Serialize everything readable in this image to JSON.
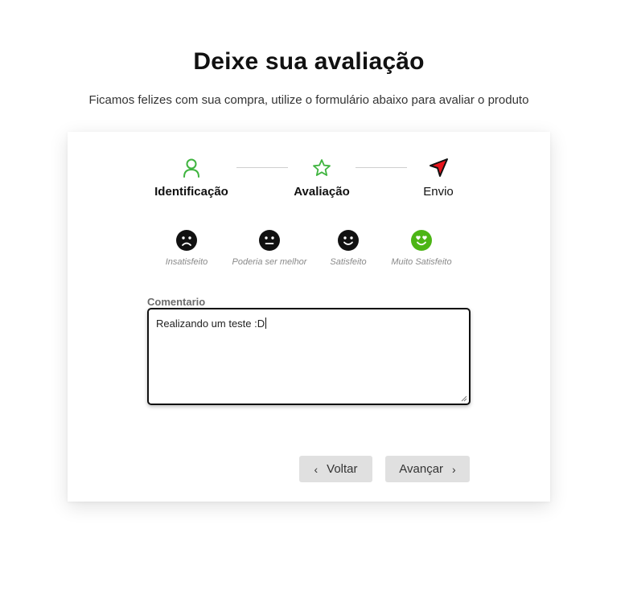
{
  "header": {
    "title": "Deixe sua avaliação",
    "subtitle": "Ficamos felizes com sua compra, utilize o formulário abaixo para avaliar o produto"
  },
  "steps": [
    {
      "label": "Identificação",
      "icon": "user-icon",
      "state": "completed"
    },
    {
      "label": "Avaliação",
      "icon": "star-icon",
      "state": "active"
    },
    {
      "label": "Envio",
      "icon": "send-icon",
      "state": "pending"
    }
  ],
  "ratings": [
    {
      "label": "Insatisfeito",
      "icon": "sad-face-icon",
      "selected": false
    },
    {
      "label": "Poderia ser melhor",
      "icon": "neutral-face-icon",
      "selected": false
    },
    {
      "label": "Satisfeito",
      "icon": "smile-face-icon",
      "selected": false
    },
    {
      "label": "Muito Satisfeito",
      "icon": "heart-eyes-face-icon",
      "selected": true
    }
  ],
  "comment": {
    "label": "Comentario",
    "value": "Realizando um teste :D"
  },
  "buttons": {
    "back": "Voltar",
    "next": "Avançar"
  },
  "colors": {
    "accent_green": "#3fb43f",
    "selected_face": "#4cb515",
    "send_red": "#e8141c",
    "button_bg": "#e0e0e0"
  }
}
